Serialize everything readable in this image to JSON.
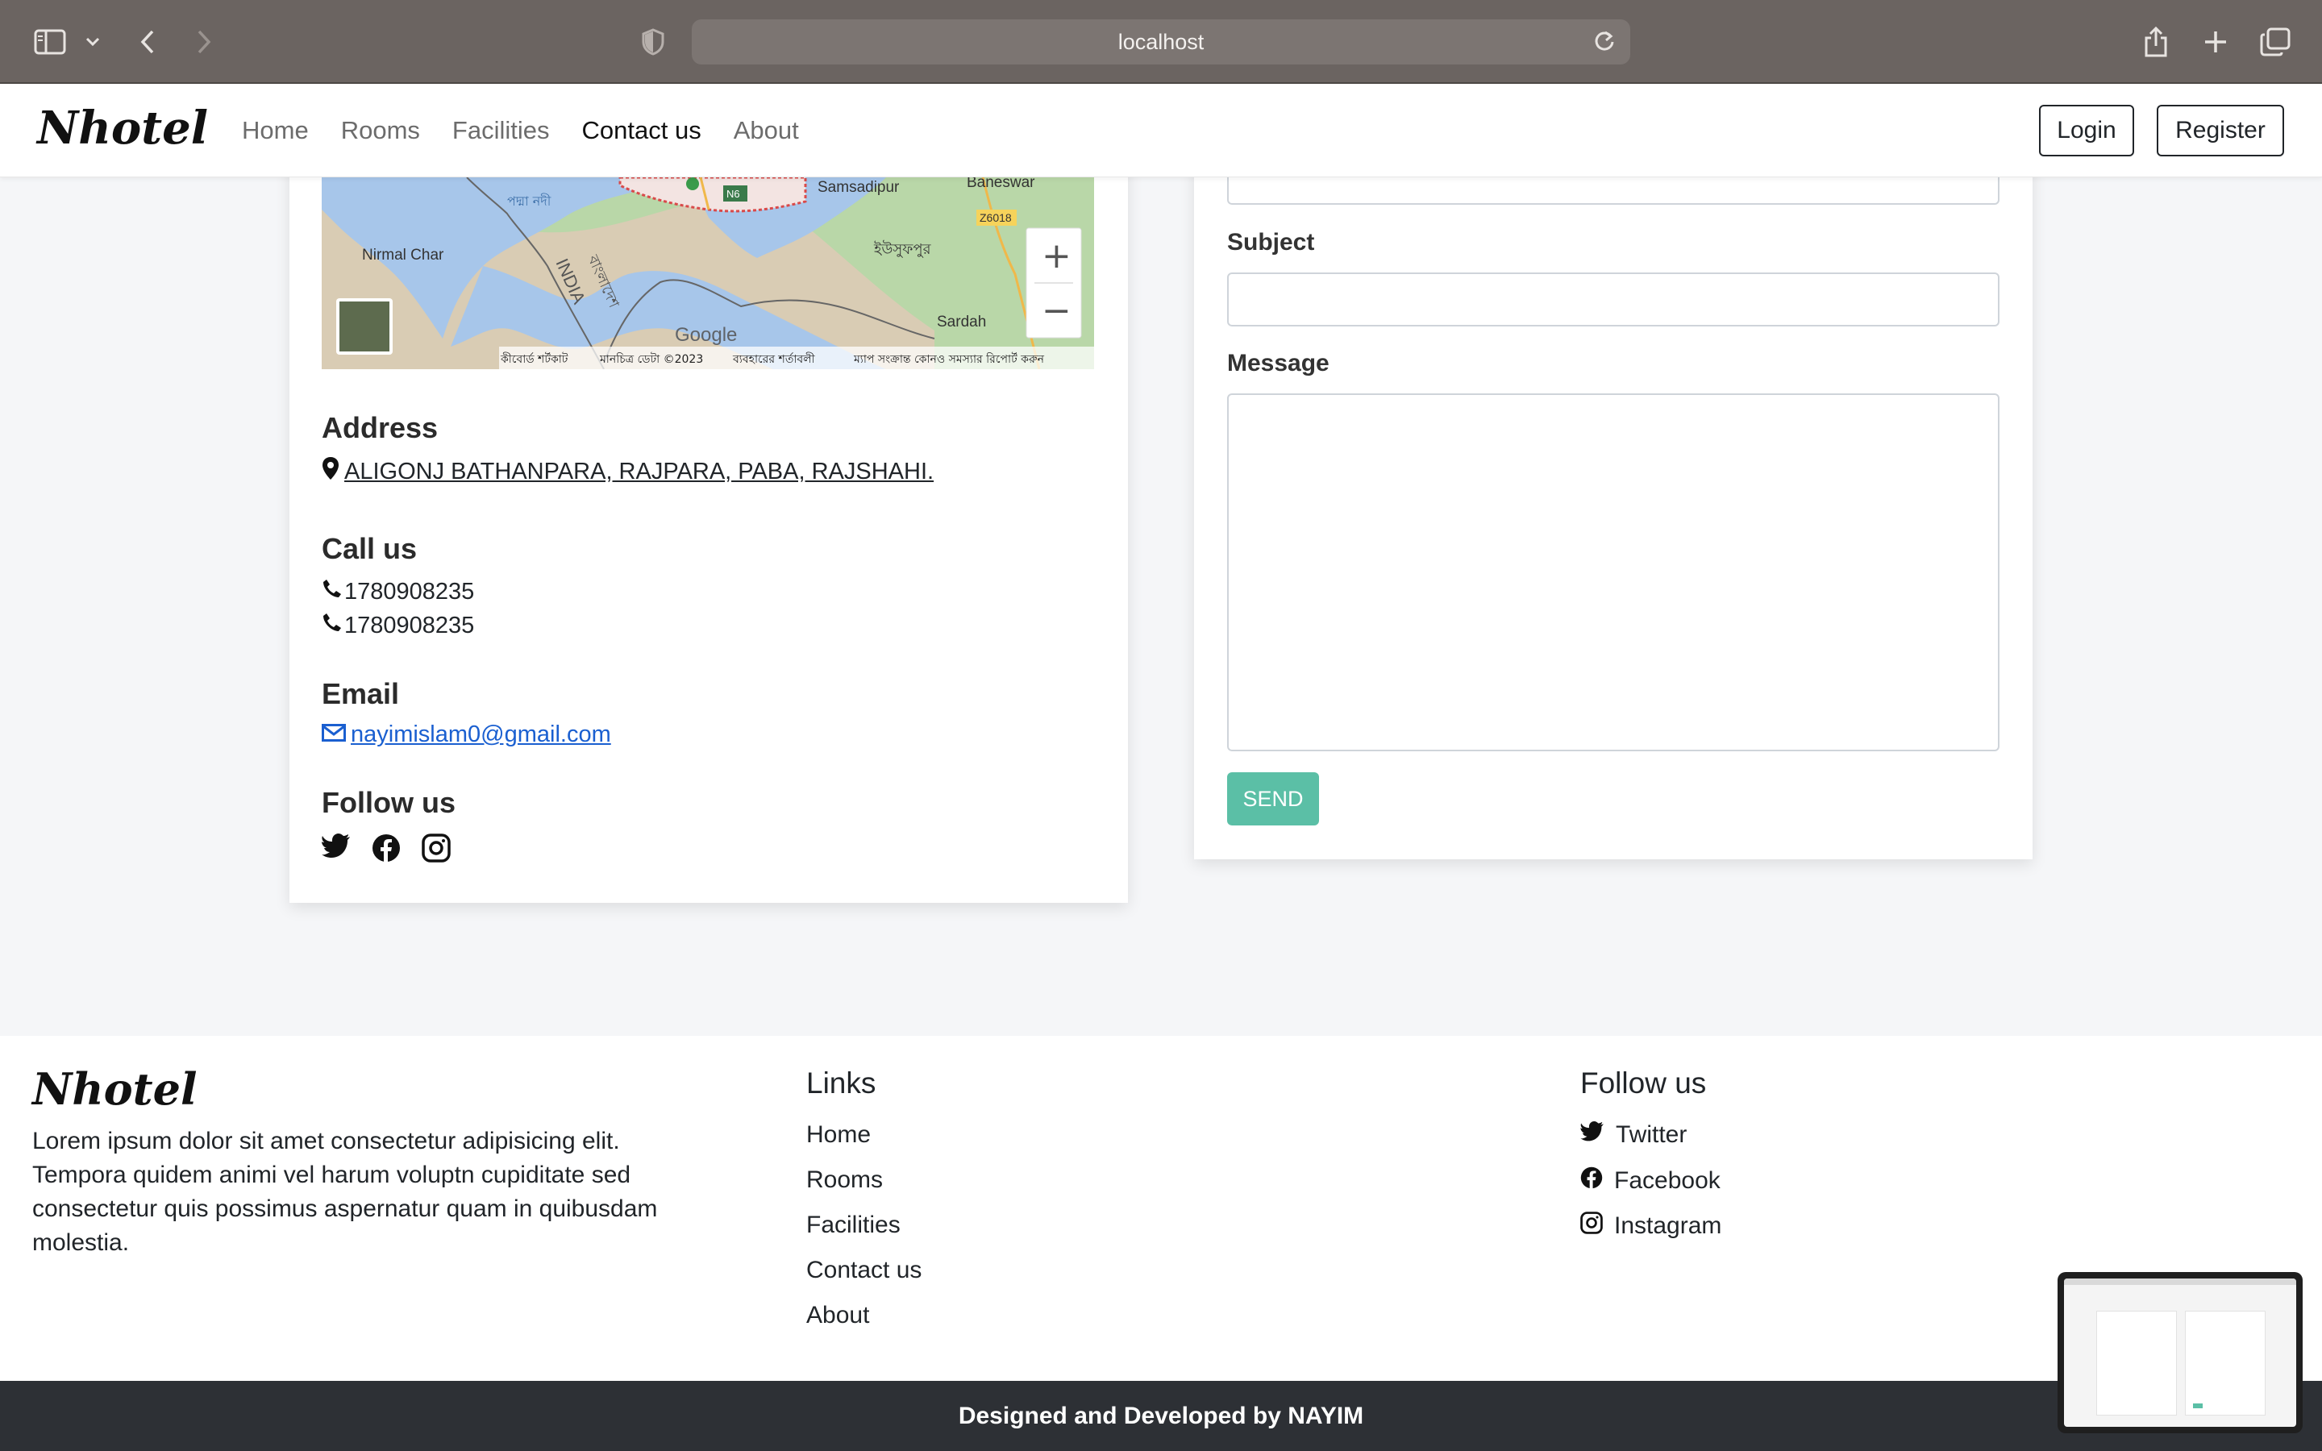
{
  "browser": {
    "url": "localhost",
    "icons": [
      "sidebar-icon",
      "chevron-down-icon",
      "back-icon",
      "forward-icon",
      "shield-icon",
      "reload-icon",
      "share-icon",
      "new-tab-icon",
      "tabs-icon"
    ]
  },
  "navbar": {
    "brand": "Nhotel",
    "links": [
      "Home",
      "Rooms",
      "Facilities",
      "Contact us",
      "About"
    ],
    "active": "Contact us",
    "login": "Login",
    "register": "Register"
  },
  "map": {
    "labels": {
      "river": "পদ্মা নদী",
      "samsadipur": "Samsadipur",
      "baneswar": "Baneswar",
      "nirmal_char": "Nirmal Char",
      "india": "INDIA",
      "bangladesh": "বাংলাদেশ",
      "yusufpur": "ইউসুফপুর",
      "sardah": "Sardah",
      "road_z6018": "Z6018",
      "road_n6": "N6",
      "google": "Google"
    },
    "footer": {
      "keyboard": "কীবোর্ড শর্টকাট",
      "data": "মানচিত্র ডেটা ©2023",
      "terms": "ব্যবহারের শর্তাবলী",
      "report": "ম্যাপ সংক্রান্ত কোনও সমস্যার রিপোর্ট করুন"
    },
    "zoom_in": "+",
    "zoom_out": "−"
  },
  "contact": {
    "address_title": "Address",
    "address": "ALIGONJ BATHANPARA, RAJPARA, PABA, RAJSHAHI.",
    "call_title": "Call us",
    "phone1": "1780908235",
    "phone2": "1780908235",
    "email_title": "Email",
    "email": "nayimislam0@gmail.com",
    "follow_title": "Follow us"
  },
  "form": {
    "subject_label": "Subject",
    "message_label": "Message",
    "send": "SEND"
  },
  "footer": {
    "brand": "Nhotel",
    "description": "Lorem ipsum dolor sit amet consectetur adipisicing elit. Tempora quidem animi vel harum voluptn cupiditate sed consectetur quis possimus aspernatur quam in quibusdam molestia.",
    "links_title": "Links",
    "links": [
      "Home",
      "Rooms",
      "Facilities",
      "Contact us",
      "About"
    ],
    "follow_title": "Follow us",
    "social": [
      "Twitter",
      "Facebook",
      "Instagram"
    ],
    "copyright": "Designed and Developed by NAYIM"
  },
  "colors": {
    "send_button": "#5bbfa6",
    "email_link": "#1a5fd0",
    "copyright_bar": "#2d3035"
  }
}
